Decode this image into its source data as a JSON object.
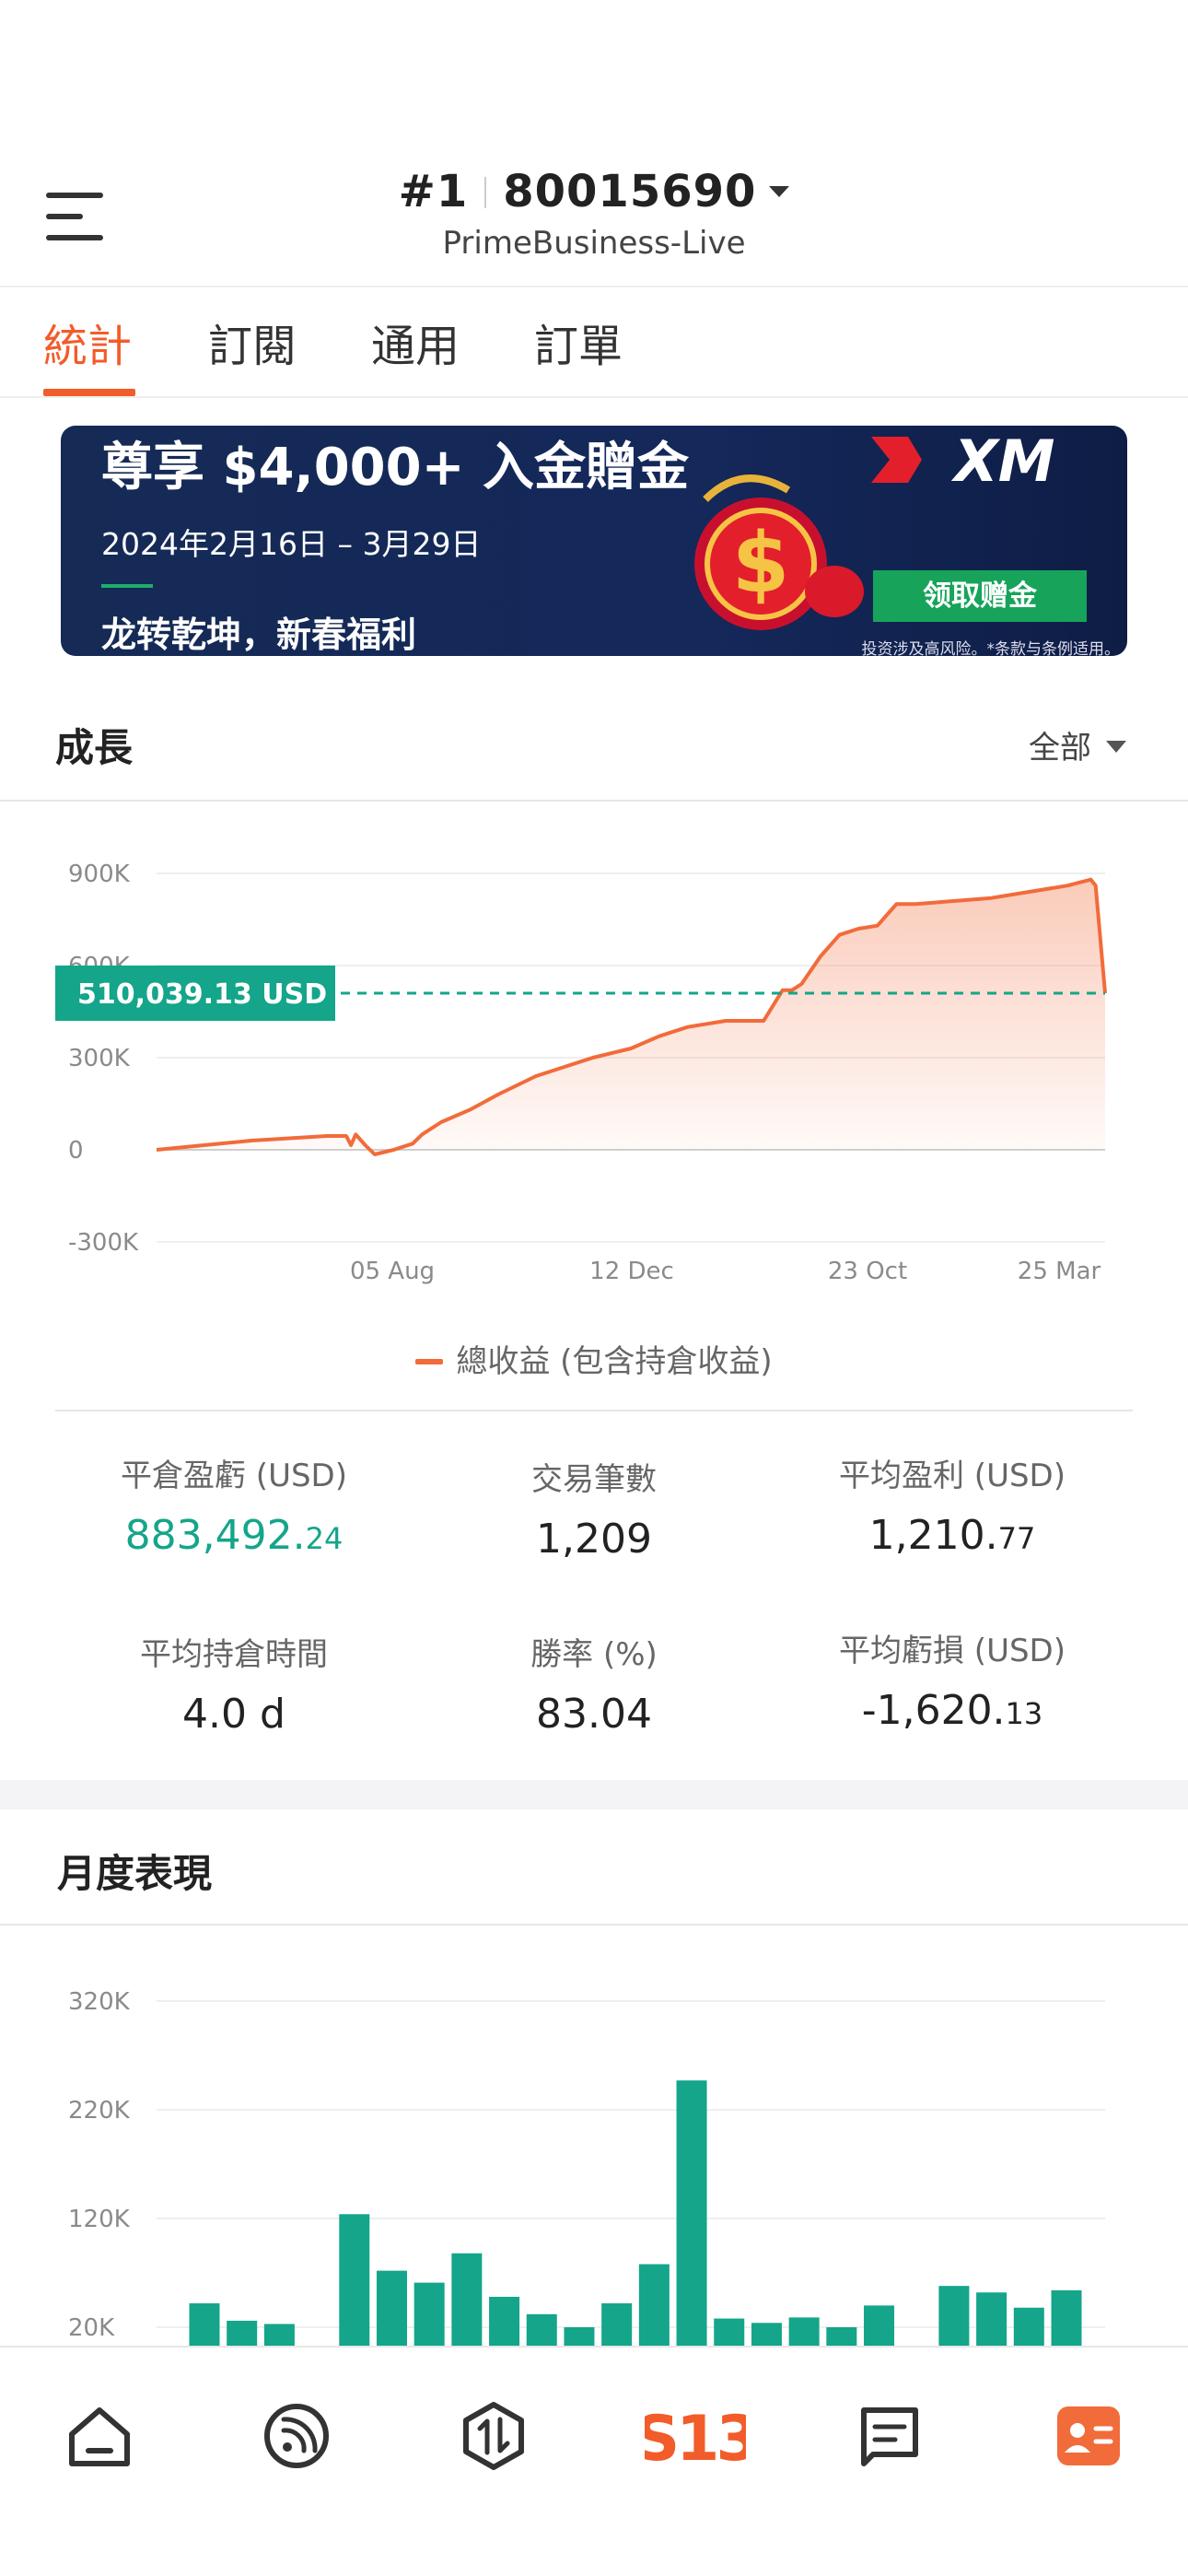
{
  "header": {
    "rank": "#1",
    "account_number": "80015690",
    "server": "PrimeBusiness-Live"
  },
  "tabs": [
    {
      "label": "統計",
      "active": true
    },
    {
      "label": "訂閱",
      "active": false
    },
    {
      "label": "通用",
      "active": false
    },
    {
      "label": "訂單",
      "active": false
    }
  ],
  "banner": {
    "headline": "尊享 $4,000+ 入金贈金",
    "date_range": "2024年2月16日 – 3月29日",
    "tagline": "龙转乾坤，新春福利",
    "brand": "XM",
    "cta_label": "领取赠金",
    "disclaimer": "投资涉及高风险。*条款与条例适用。"
  },
  "growth": {
    "title": "成長",
    "filter_label": "全部",
    "current_value_label": "510,039.13 USD",
    "legend_label": "總收益 (包含持倉收益)"
  },
  "stats": {
    "closed_pnl": {
      "label": "平倉盈虧 (USD)",
      "value_main": "883,492.",
      "value_decimal": "24"
    },
    "trade_count": {
      "label": "交易筆數",
      "value": "1,209"
    },
    "avg_profit": {
      "label": "平均盈利 (USD)",
      "value_main": "1,210.",
      "value_decimal": "77"
    },
    "avg_hold_time": {
      "label": "平均持倉時間",
      "value": "4.0 d"
    },
    "win_rate": {
      "label": "勝率 (%)",
      "value": "83.04"
    },
    "avg_loss": {
      "label": "平均虧損 (USD)",
      "value_main": "-1,620.",
      "value_decimal": "13"
    }
  },
  "monthly": {
    "title": "月度表現"
  },
  "bottom_nav": [
    {
      "name": "home-icon"
    },
    {
      "name": "feed-icon"
    },
    {
      "name": "trade-icon"
    },
    {
      "name": "s13-icon"
    },
    {
      "name": "messages-icon"
    },
    {
      "name": "profile-card-icon"
    }
  ],
  "colors": {
    "accent": "#f25c2a",
    "green": "#14a58a",
    "bar": "#14a58a",
    "line": "#f26b3a"
  },
  "chart_data": [
    {
      "type": "area",
      "title": "",
      "xlabel": "",
      "ylabel": "",
      "y_ticks": [
        "900K",
        "600K",
        "300K",
        "0",
        "-300K"
      ],
      "x_ticks": [
        "05 Aug",
        "12 Dec",
        "23 Oct",
        "25 Mar"
      ],
      "ylim": [
        -300000,
        900000
      ],
      "reference_value": 510039.13,
      "grid": true,
      "series": [
        {
          "name": "總收益 (包含持倉收益)",
          "x": [
            0,
            0.05,
            0.1,
            0.18,
            0.2,
            0.205,
            0.21,
            0.22,
            0.23,
            0.25,
            0.27,
            0.28,
            0.3,
            0.33,
            0.36,
            0.4,
            0.43,
            0.46,
            0.5,
            0.53,
            0.56,
            0.6,
            0.64,
            0.66,
            0.67,
            0.68,
            0.7,
            0.72,
            0.74,
            0.76,
            0.78,
            0.8,
            0.84,
            0.88,
            0.92,
            0.96,
            0.985,
            0.99,
            1.0
          ],
          "values": [
            0,
            15000,
            30000,
            45000,
            45000,
            15000,
            50000,
            15000,
            -15000,
            0,
            20000,
            50000,
            90000,
            130000,
            180000,
            240000,
            270000,
            300000,
            330000,
            370000,
            400000,
            420000,
            420000,
            520000,
            520000,
            540000,
            630000,
            700000,
            720000,
            730000,
            800000,
            800000,
            810000,
            820000,
            840000,
            860000,
            880000,
            860000,
            510039
          ]
        }
      ]
    },
    {
      "type": "bar",
      "title": "",
      "y_ticks": [
        "320K",
        "220K",
        "120K",
        "20K"
      ],
      "ylim": [
        20000,
        320000
      ],
      "values": [
        42000,
        26000,
        23000,
        0,
        124000,
        72000,
        61000,
        88000,
        48000,
        32000,
        20000,
        42000,
        78000,
        247000,
        28000,
        24000,
        29000,
        20000,
        40000,
        0,
        58000,
        52000,
        38000,
        54000
      ]
    }
  ]
}
